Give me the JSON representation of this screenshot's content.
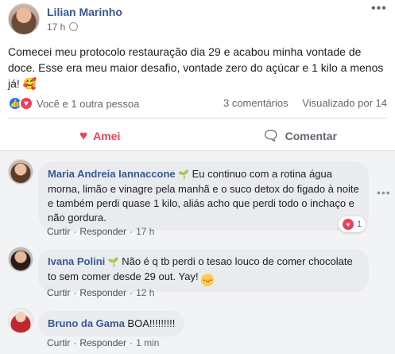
{
  "post": {
    "author": "Lilian Marinho",
    "time": "17 h",
    "more_icon": "more-icon",
    "text": "Comecei meu protocolo restauração dia 29 e acabou minha vontade de doce. Esse era meu maior desafio, vontade zero do açúcar e 1 kilo a menos já! 🥰",
    "reactions_text": "Você e 1 outra pessoa",
    "comments_count": "3 comentários",
    "views": "Visualizado por 14"
  },
  "actions": {
    "love": "Amei",
    "comment": "Comentar"
  },
  "comments": [
    {
      "name": "Maria Andreia Iannaccone",
      "text": "Eu continuo com a rotina água morna, limão e vinagre pela manhã e o suco detox do figado à noite e também perdi quase 1 kilo, aliás acho que perdi todo o inchaço e não gordura.",
      "reply": "Curtir",
      "respond": "Responder",
      "time": "17 h",
      "reaction_count": "1"
    },
    {
      "name": "Ivana Polini",
      "text": "Não é q tb perdi o tesao louco de comer chocolate to sem comer desde 29 out. Yay!",
      "reply": "Curtir",
      "respond": "Responder",
      "time": "12 h"
    },
    {
      "name": "Bruno da Gama",
      "text": "BOA!!!!!!!!!",
      "reply": "Curtir",
      "respond": "Responder",
      "time": "1 min"
    }
  ],
  "colors": {
    "link": "#385898",
    "love": "#f33e58",
    "like": "#1877f2"
  }
}
